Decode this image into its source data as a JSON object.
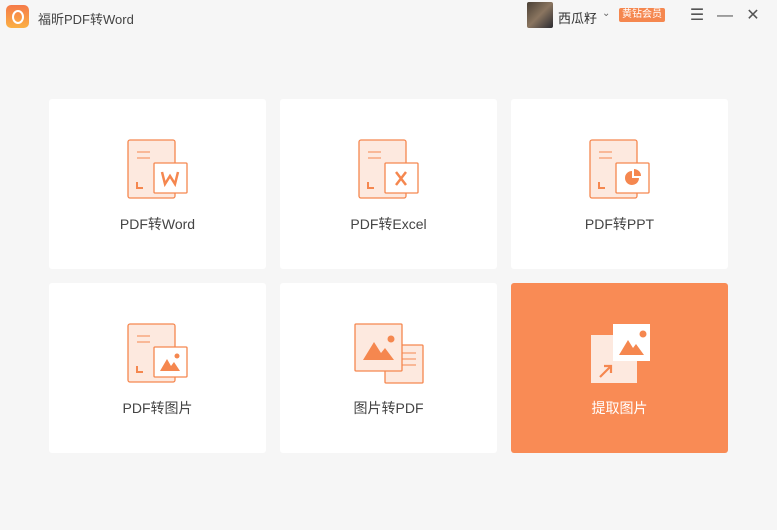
{
  "app": {
    "title": "福昕PDF转Word"
  },
  "user": {
    "name": "西瓜籽",
    "badge": "黄钻会员"
  },
  "window": {
    "menu_icon": "menu-icon",
    "minimize_icon": "minimize-icon",
    "close_icon": "close-icon"
  },
  "accent": "#f98b55",
  "cards": [
    {
      "label": "PDF转Word",
      "icon": "word"
    },
    {
      "label": "PDF转Excel",
      "icon": "excel"
    },
    {
      "label": "PDF转PPT",
      "icon": "ppt"
    },
    {
      "label": "PDF转图片",
      "icon": "image"
    },
    {
      "label": "图片转PDF",
      "icon": "img2pdf"
    },
    {
      "label": "提取图片",
      "icon": "extract"
    }
  ]
}
